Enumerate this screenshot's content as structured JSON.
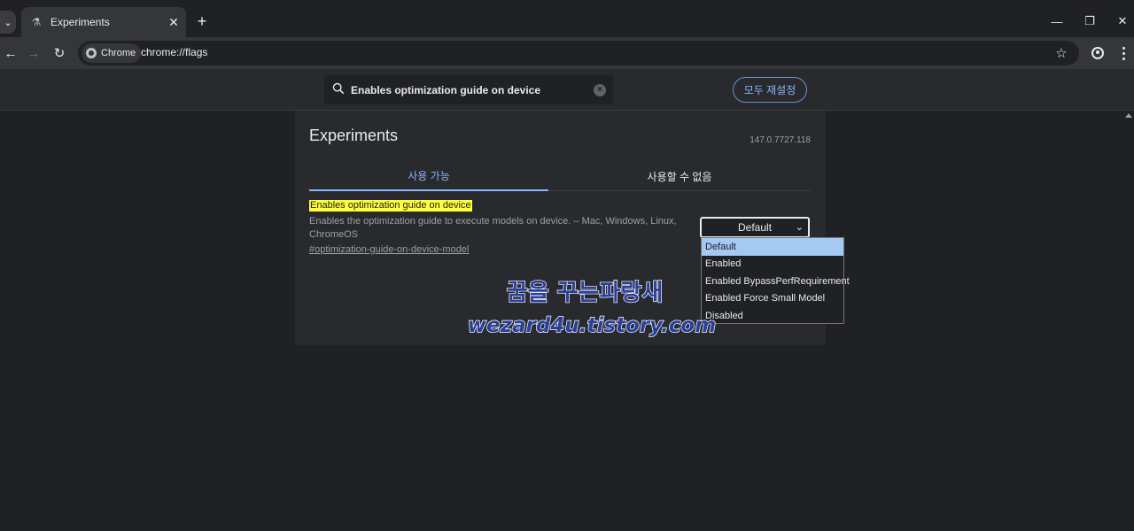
{
  "browser": {
    "tab": {
      "title": "Experiments",
      "favicon": "flask-icon"
    },
    "omnibox": {
      "chip_label": "Chrome",
      "url": "chrome://flags"
    }
  },
  "header": {
    "search": {
      "value": "Enables optimization guide on device",
      "placeholder": ""
    },
    "reset_label": "모두 재설정"
  },
  "main": {
    "title": "Experiments",
    "version": "147.0.7727.118",
    "tabs": [
      {
        "label": "사용 가능",
        "active": true
      },
      {
        "label": "사용할 수 없음",
        "active": false
      }
    ],
    "flag": {
      "name": "Enables optimization guide on device",
      "description": "Enables the optimization guide to execute models on device. – Mac, Windows, Linux, ChromeOS",
      "link": "#optimization-guide-on-device-model",
      "selected": "Default",
      "options": [
        "Default",
        "Enabled",
        "Enabled BypassPerfRequirement",
        "Enabled Force Small Model",
        "Disabled"
      ]
    }
  },
  "watermark": {
    "line1": "꿈을 꾸는파랑새",
    "line2": "wezard4u.tistory.com"
  },
  "colors": {
    "accent": "#8ab4f8",
    "highlight": "#ffff3c",
    "selected_option": "#a4c9f2"
  }
}
